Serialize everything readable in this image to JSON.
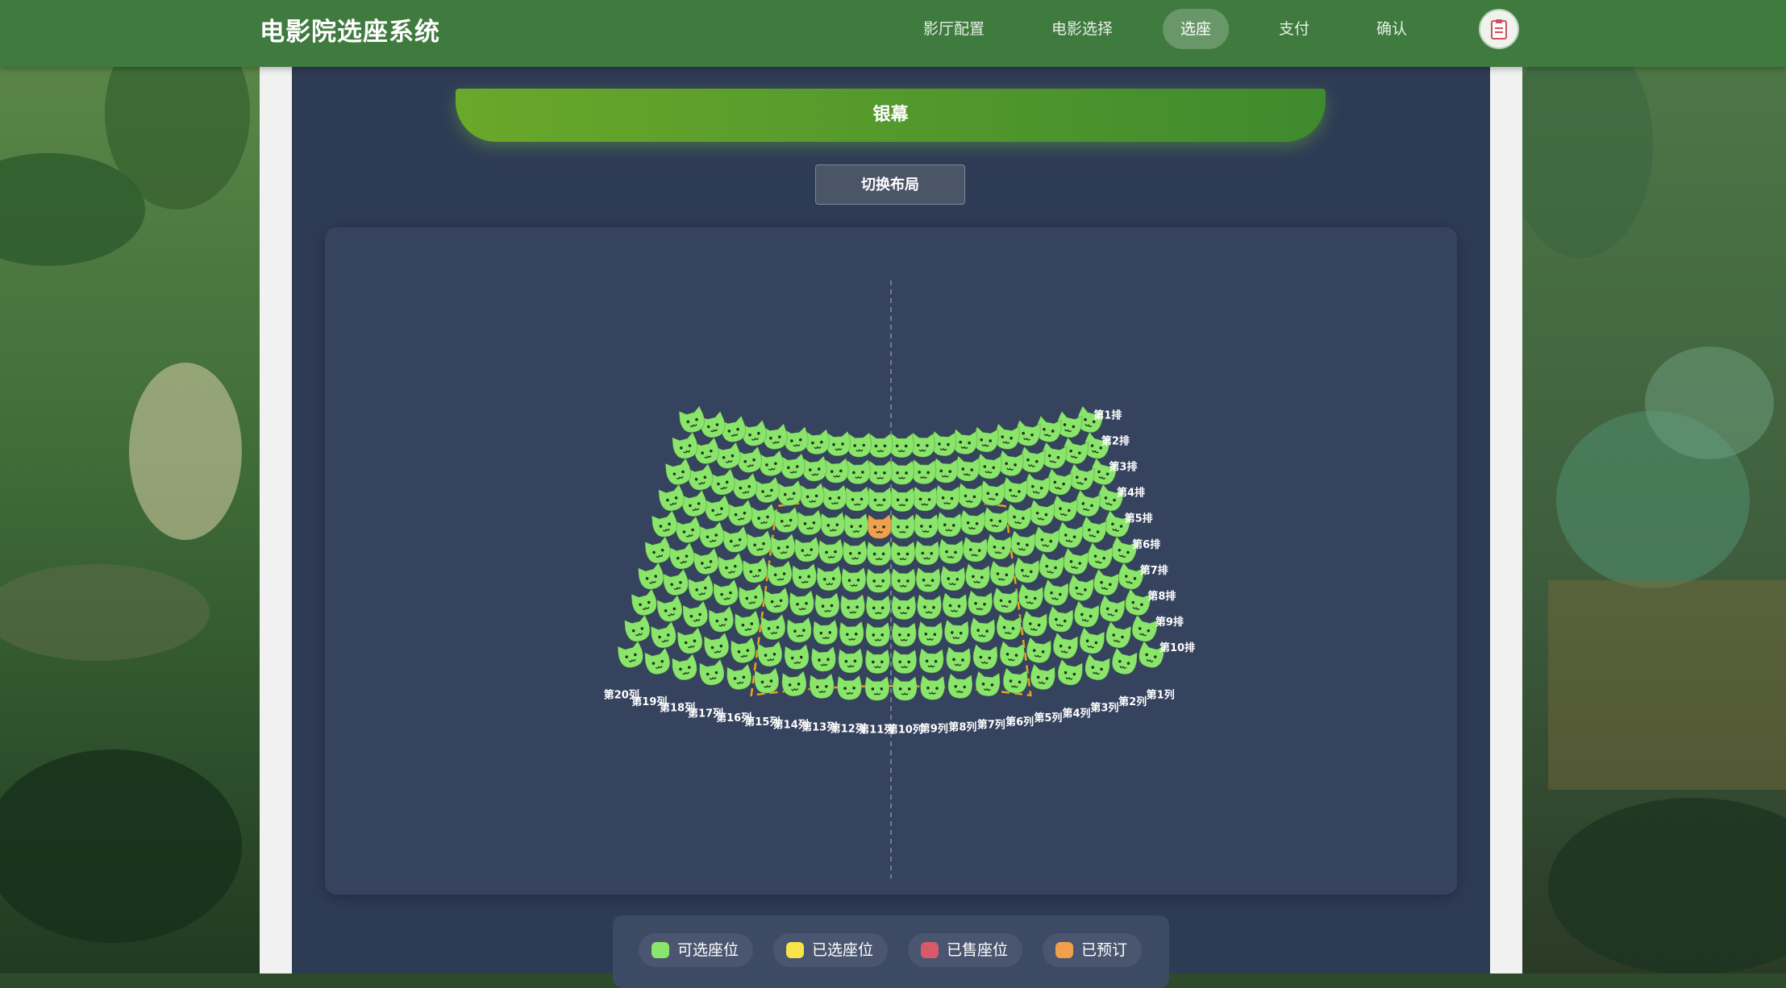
{
  "app": {
    "title": "电影院选座系统"
  },
  "nav": {
    "items": [
      {
        "label": "影厅配置",
        "active": false
      },
      {
        "label": "电影选择",
        "active": false
      },
      {
        "label": "选座",
        "active": true
      },
      {
        "label": "支付",
        "active": false
      },
      {
        "label": "确认",
        "active": false
      }
    ],
    "avatar_icon": "clipboard-icon"
  },
  "screen": {
    "label": "银幕"
  },
  "controls": {
    "switch_layout_label": "切换布局"
  },
  "seat_map": {
    "rows": 10,
    "cols": 20,
    "seat_icon": "cat-face-icon",
    "row_labels": [
      "第1排",
      "第2排",
      "第3排",
      "第4排",
      "第5排",
      "第6排",
      "第7排",
      "第8排",
      "第9排",
      "第10排"
    ],
    "col_labels": [
      "第1列",
      "第2列",
      "第3列",
      "第4列",
      "第5列",
      "第6列",
      "第7列",
      "第8列",
      "第9列",
      "第10列",
      "第11列",
      "第12列",
      "第13列",
      "第14列",
      "第15列",
      "第16列",
      "第17列",
      "第18列",
      "第19列",
      "第20列"
    ],
    "reserved_seats": [
      {
        "row": 4,
        "col": 11
      }
    ],
    "highlight_zone": {
      "rows": [
        4,
        10
      ],
      "cols": [
        6,
        15
      ]
    },
    "colors": {
      "available": "#8ae66a",
      "reserved": "#f0a04c",
      "zone_border": "#f0a020",
      "center_line": "#8891a6"
    }
  },
  "legend": {
    "items": [
      {
        "label": "可选座位",
        "color": "#8ae66a"
      },
      {
        "label": "已选座位",
        "color": "#f7e44a"
      },
      {
        "label": "已售座位",
        "color": "#d85a6a"
      },
      {
        "label": "已预订",
        "color": "#f0a04c"
      }
    ]
  }
}
